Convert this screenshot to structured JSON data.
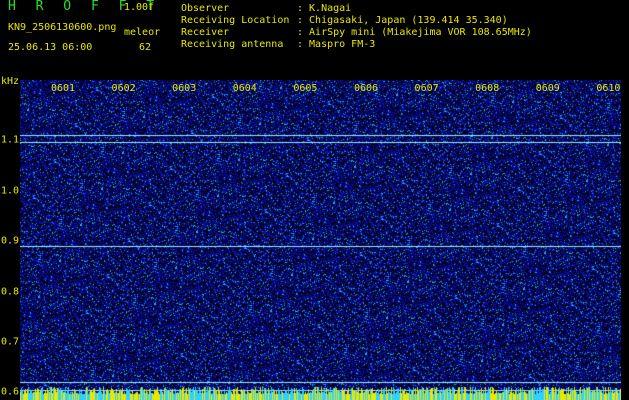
{
  "header": {
    "logo": "H R O F F T",
    "version": "1.00f",
    "filename": "KN9_2506130600.png",
    "station": "meleor",
    "datetime": "25.06.13 06:00",
    "count": "62"
  },
  "meta": [
    {
      "label": "Observer",
      "value": ": K.Nagai"
    },
    {
      "label": "Receiving Location",
      "value": ": Chigasaki, Japan (139.414 35.340)"
    },
    {
      "label": "Receiver",
      "value": ": AirSpy mini (Miakejima VOR 108.65MHz)"
    },
    {
      "label": "Receiving antenna",
      "value": ": Maspro FM-3"
    }
  ],
  "plot": {
    "unit": "kHz",
    "x_ticks": [
      "0601",
      "0602",
      "0603",
      "0604",
      "0605",
      "0606",
      "0607",
      "0608",
      "0609",
      "0610"
    ],
    "y_ticks": [
      "1.1",
      "1.0",
      "0.9",
      "0.8",
      "0.7",
      "0.6"
    ],
    "y_range": [
      0.585,
      1.22
    ],
    "signal_lines_khz": [
      1.11,
      1.097,
      0.891,
      0.62,
      0.605
    ],
    "colors": {
      "noise": "#1a2fd6",
      "background": "#000033",
      "lines": "#9ee8ff",
      "labels": "#e8e800"
    }
  }
}
